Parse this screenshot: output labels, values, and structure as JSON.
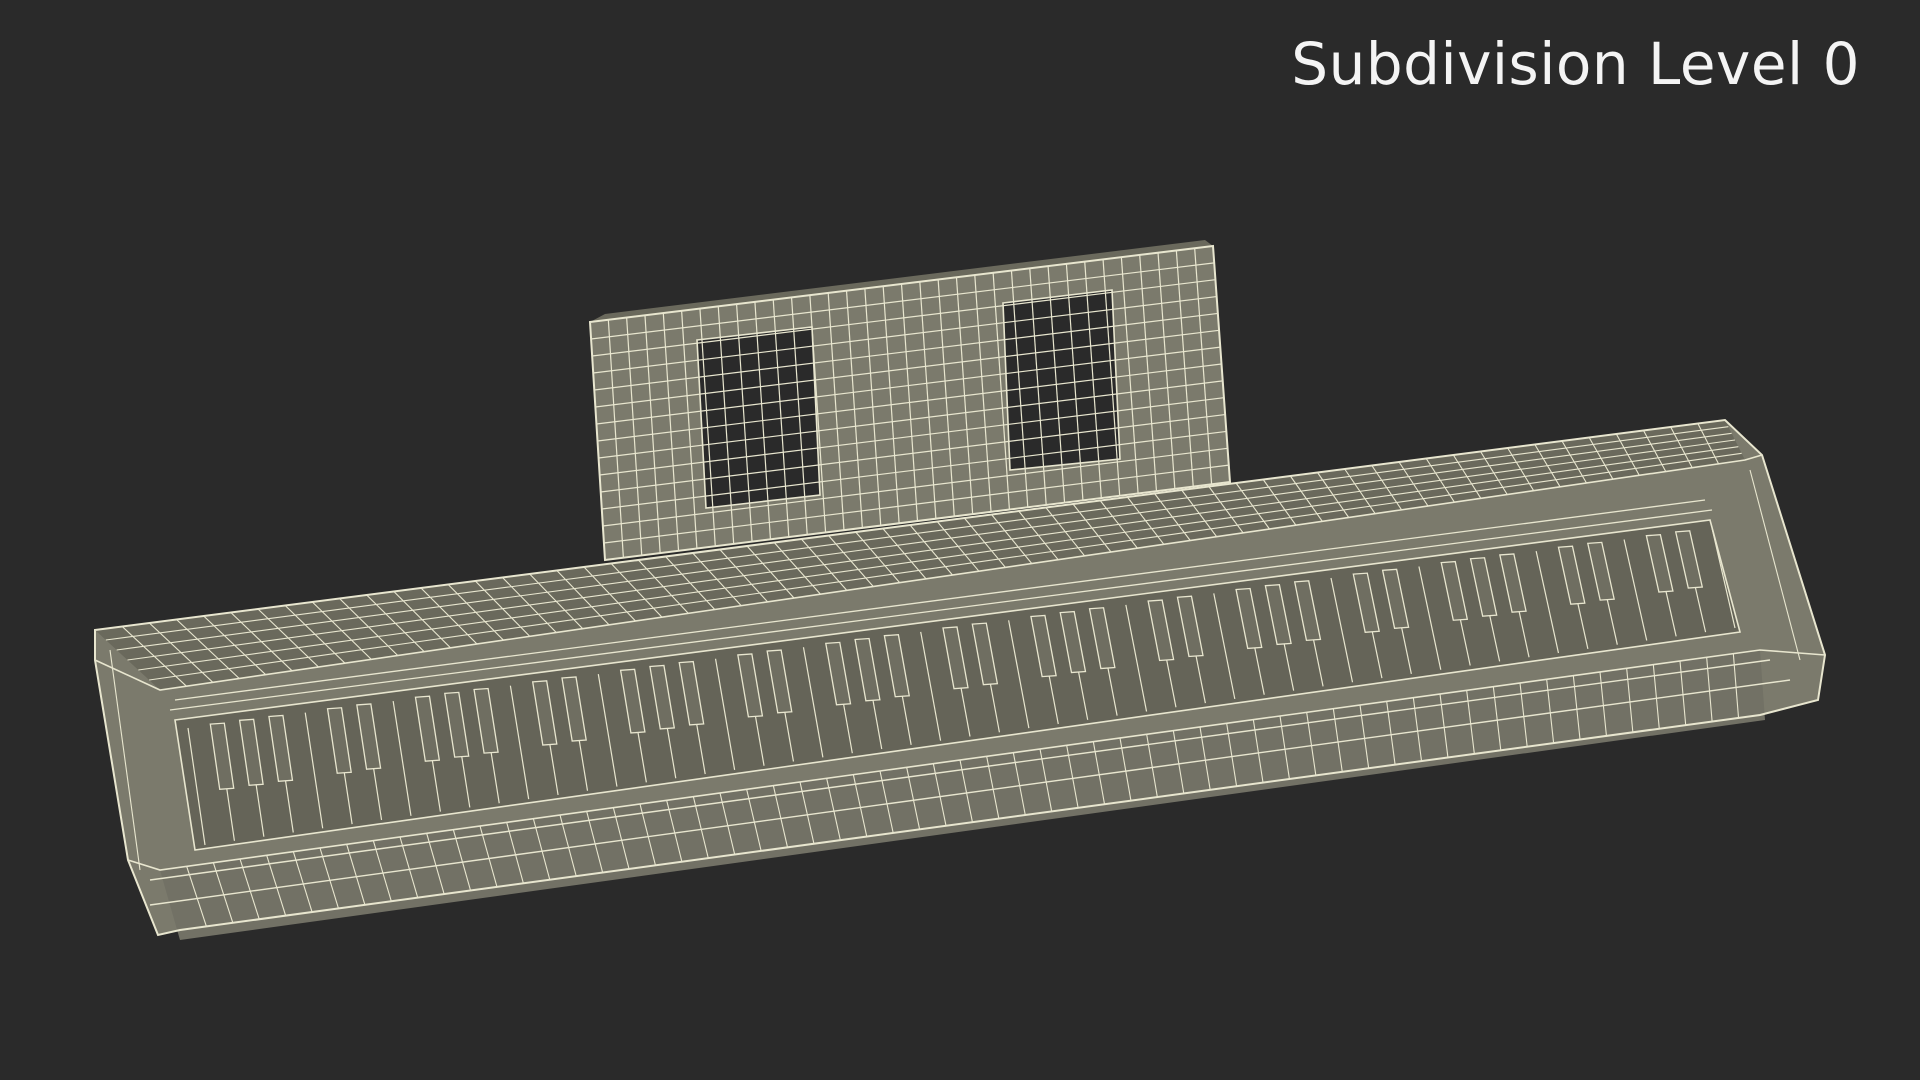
{
  "overlay": {
    "label": "Subdivision Level 0"
  },
  "scene": {
    "subject_icon": "keyboard-wireframe",
    "background_color": "#2a2a2a",
    "mesh_fill_color": "#7b7a6c",
    "wire_color": "#e8e6cf",
    "white_key_count": 52,
    "black_key_count": 36
  }
}
